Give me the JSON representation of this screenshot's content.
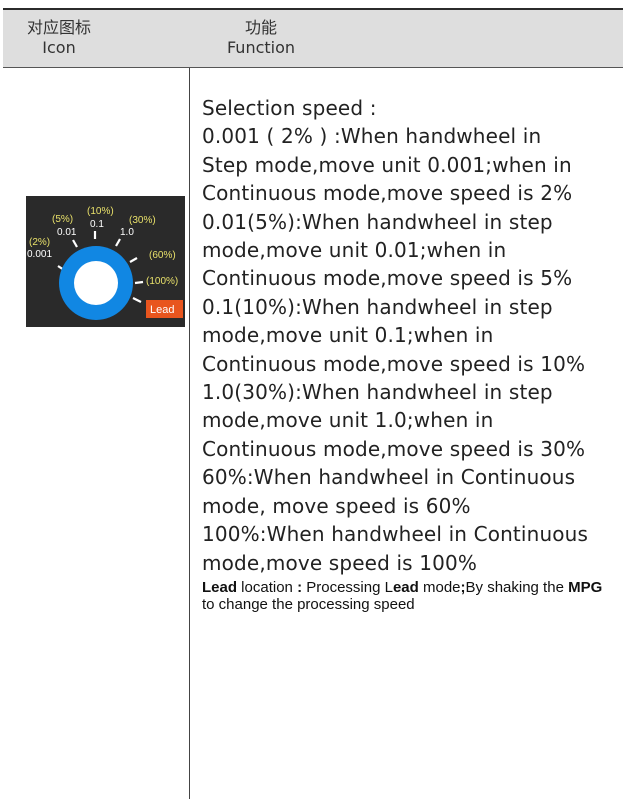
{
  "header": {
    "col1_cn": "对应图标",
    "col1_en": "Icon",
    "col2_cn": "功能",
    "col2_en": "Function"
  },
  "dial": {
    "labels": {
      "p2": "(2%)",
      "v0001": "0.001",
      "p5": "(5%)",
      "v001": "0.01",
      "p10": "(10%)",
      "v01": "0.1",
      "p30": "(30%)",
      "v10": "1.0",
      "p60": "(60%)",
      "p100": "(100%)",
      "lead": "Lead"
    },
    "colors": {
      "ring": "#1187e3",
      "inner": "#ffffff",
      "background": "#2a2a2a",
      "percent_text": "#e8e06a",
      "value_text": "#ffffff",
      "lead_badge": "#e8551e"
    }
  },
  "function_lines": [
    "Selection speed :",
    "0.001 ( 2% ) :When handwheel in",
    "Step mode,move unit 0.001;when in",
    "Continuous mode,move speed is 2%",
    "0.01(5%):When handwheel in step",
    "mode,move unit 0.01;when in",
    "Continuous mode,move speed is 5%",
    "0.1(10%):When handwheel in step",
    "mode,move unit 0.1;when in",
    "Continuous mode,move speed is 10%",
    "1.0(30%):When handwheel in step",
    "mode,move unit 1.0;when in",
    "Continuous mode,move speed is 30%",
    "60%:When handwheel in Continuous",
    "mode, move speed is 60%",
    "100%:When handwheel in Continuous",
    "mode,move speed is 100%"
  ],
  "lead_note": {
    "bold1": "Lead",
    "text1": " location ",
    "colon": ":",
    "text2": " Processing L",
    "bold2": "ead",
    "text3": " mode",
    "semicolon": ";",
    "text4": "By shaking the ",
    "bold3": "MPG",
    "text5": " to change the processing speed"
  }
}
